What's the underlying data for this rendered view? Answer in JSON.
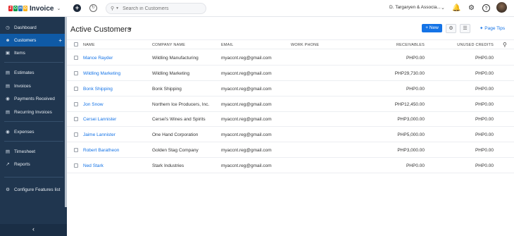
{
  "app": {
    "name": "Invoice",
    "logo_letters": [
      "Z",
      "O",
      "H",
      "O"
    ],
    "logo_colors": [
      "#e42527",
      "#089949",
      "#226db4",
      "#f9b21d"
    ]
  },
  "topbar": {
    "search_placeholder": "Search in Customers",
    "org_name": "D. Targaryen & Associa..."
  },
  "sidebar": {
    "items": [
      {
        "label": "Dashboard",
        "icon": "dashboard-icon"
      },
      {
        "label": "Customers",
        "icon": "customers-icon",
        "active": true
      },
      {
        "label": "Items",
        "icon": "items-icon"
      },
      {
        "label": "Estimates",
        "icon": "estimates-icon"
      },
      {
        "label": "Invoices",
        "icon": "invoices-icon"
      },
      {
        "label": "Payments Received",
        "icon": "payments-icon"
      },
      {
        "label": "Recurring Invoices",
        "icon": "recurring-icon"
      },
      {
        "label": "Expenses",
        "icon": "expenses-icon"
      },
      {
        "label": "Timesheet",
        "icon": "timesheet-icon"
      },
      {
        "label": "Reports",
        "icon": "reports-icon"
      }
    ],
    "configure_label": "Configure Features list",
    "collapse_glyph": "‹"
  },
  "main": {
    "title": "Active Customers",
    "new_button": "+ New",
    "page_tips": "Page Tips",
    "columns": [
      "NAME",
      "COMPANY NAME",
      "EMAIL",
      "WORK PHONE",
      "RECEIVABLES",
      "UNUSED CREDITS"
    ],
    "rows": [
      {
        "name": "Mance Rayder",
        "company": "Wildling Manufacturing",
        "email": "myaccnt.reg@gmail.com",
        "phone": "",
        "receivables": "PHP0.00",
        "credits": "PHP0.00"
      },
      {
        "name": "Wildling Marketing",
        "company": "Wildling Marketing",
        "email": "myaccnt.reg@gmail.com",
        "phone": "",
        "receivables": "PHP29,730.00",
        "credits": "PHP0.00"
      },
      {
        "name": "Bonk Shipping",
        "company": "Bonk Shipping",
        "email": "myaccnt.reg@gmail.com",
        "phone": "",
        "receivables": "PHP0.00",
        "credits": "PHP0.00"
      },
      {
        "name": "Jon Snow",
        "company": "Northern Ice Producers, Inc.",
        "email": "myaccnt.reg@gmail.com",
        "phone": "",
        "receivables": "PHP12,450.00",
        "credits": "PHP0.00"
      },
      {
        "name": "Cersei Lannister",
        "company": "Cersei's Wines and Spirits",
        "email": "myaccnt.reg@gmail.com",
        "phone": "",
        "receivables": "PHP3,000.00",
        "credits": "PHP0.00"
      },
      {
        "name": "Jaime Lannister",
        "company": "One Hand Corporation",
        "email": "myaccnt.reg@gmail.com",
        "phone": "",
        "receivables": "PHP5,000.00",
        "credits": "PHP0.00"
      },
      {
        "name": "Robert Baratheon",
        "company": "Golden Stag Company",
        "email": "myaccnt.reg@gmail.com",
        "phone": "",
        "receivables": "PHP3,000.00",
        "credits": "PHP0.00"
      },
      {
        "name": "Ned Stark",
        "company": "Stark Industries",
        "email": "myaccnt.reg@gmail.com",
        "phone": "",
        "receivables": "PHP0.00",
        "credits": "PHP0.00"
      }
    ]
  }
}
